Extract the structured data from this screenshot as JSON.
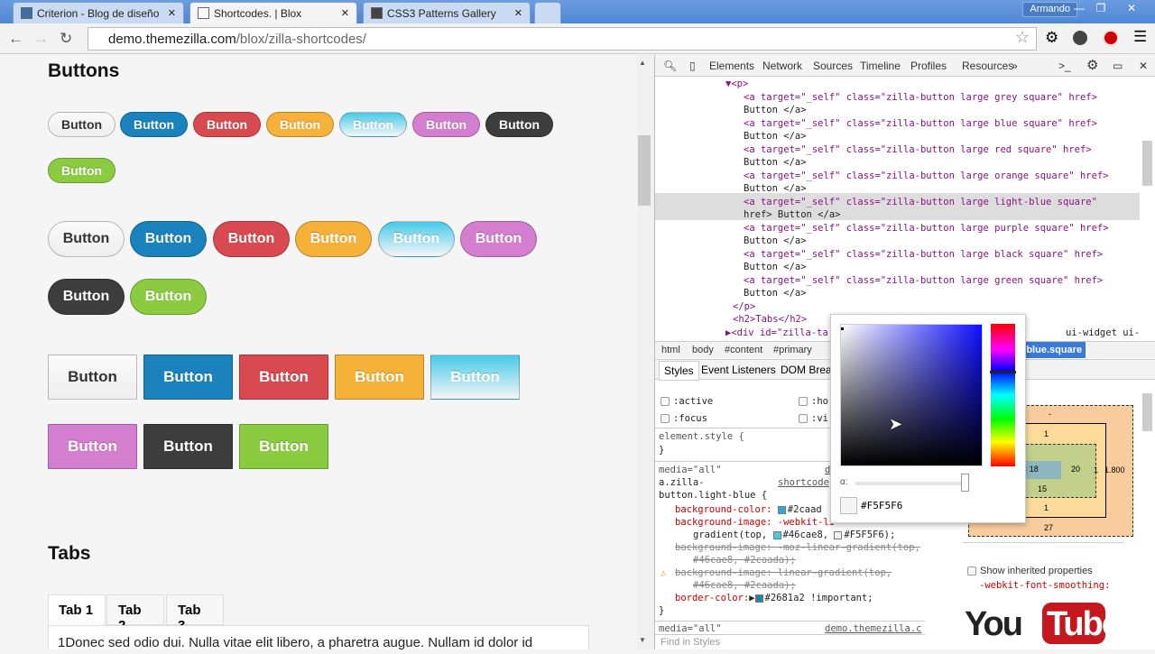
{
  "browser": {
    "tabs": [
      {
        "label": "Criterion - Blog de diseño"
      },
      {
        "label": "Shortcodes. | Blox",
        "active": true
      },
      {
        "label": "CSS3 Patterns Gallery"
      }
    ],
    "user": "Armando",
    "url_host": "demo.themezilla.com",
    "url_path": "/blox/zilla-shortcodes/"
  },
  "page": {
    "buttons_heading": "Buttons",
    "tabs_heading": "Tabs",
    "button_label": "Button",
    "colors": {
      "grey": "#eeeeee",
      "blue": "#1a83bd",
      "red": "#d84a4f",
      "orange": "#f5b138",
      "light-blue": "#bde9f7",
      "purple": "#d47ed0",
      "black": "#3d3d3d",
      "green": "#8bcb3f"
    },
    "tabs": [
      "Tab 1",
      "Tab 2",
      "Tab 3"
    ],
    "tab_content": "1Donec sed odio dui. Nulla vitae elit libero, a pharetra augue. Nullam id dolor id"
  },
  "devtools": {
    "tabs": [
      "Elements",
      "Network",
      "Sources",
      "Timeline",
      "Profiles",
      "Resources",
      "»"
    ],
    "dom_lines": [
      "▼<p>",
      "<a target=\"_self\" class=\"zilla-button large grey square\" href>",
      "Button </a>",
      "<a target=\"_self\" class=\"zilla-button large blue square\" href>",
      "Button </a>",
      "<a target=\"_self\" class=\"zilla-button large red square\" href>",
      "Button </a>",
      "<a target=\"_self\" class=\"zilla-button large orange square\" href>",
      "Button </a>",
      "<a target=\"_self\" class=\"zilla-button large light-blue square\"",
      "href> Button </a>",
      "<a target=\"_self\" class=\"zilla-button large purple square\" href>",
      "Button </a>",
      "<a target=\"_self\" class=\"zilla-button large black square\" href>",
      "Button </a>",
      "<a target=\"_self\" class=\"zilla-button large green square\" href>",
      "Button </a>",
      "</p>",
      "<h2>Tabs</h2>",
      "▶<div id=\"zilla-ta",
      "ui-widget ui-"
    ],
    "breadcrumbs": [
      "html",
      "body",
      "#content",
      "#primary",
      "t-blue.square"
    ],
    "style_tabs": [
      "Styles",
      "Event Listeners",
      "DOM Brea"
    ],
    "states": [
      ":active",
      ":focus",
      ":ho",
      ":vi"
    ],
    "element_style": "element.style {",
    "close_brace": "}",
    "rule": {
      "media": "media=\"all\"",
      "source": "shortcode",
      "source_d": "d",
      "selector1": "a.zilla-",
      "selector2": "button.light-blue {",
      "l1": "background-color:",
      "l1v": "#2caad",
      "l2": "background-image: -webkit-li",
      "l3": "gradient(top,",
      "l3a": "#46cae8,",
      "l3b": "#F5F5F6);",
      "l4": "background-image: -moz-linear-gradient(top,",
      "l5": "#46cae8, #2caada);",
      "l6": "background-image: linear-gradient(top,",
      "l7": "#46cae8, #2caada);",
      "l8": "border-color:",
      "l8v": "#2681a2 !important;"
    },
    "media2": "media=\"all\"",
    "source2": "demo.themezilla.c",
    "find": "Find in Styles",
    "picker": {
      "alpha": "α:",
      "hex": "#F5F5F6"
    },
    "boxmodel": {
      "margin": "-",
      "border_top": "1",
      "padding_top": "15",
      "content": "7.984 × 18",
      "padding_right": "20",
      "border_right": "1",
      "margin_right": "1.800",
      "padding_bottom": "15",
      "border_bottom": "1",
      "margin_bottom": "27",
      "padding_label": "g"
    },
    "inherited": "Show inherited properties",
    "inherited_prop": "-webkit-font-smoothing:"
  },
  "watermark": "YouTube"
}
